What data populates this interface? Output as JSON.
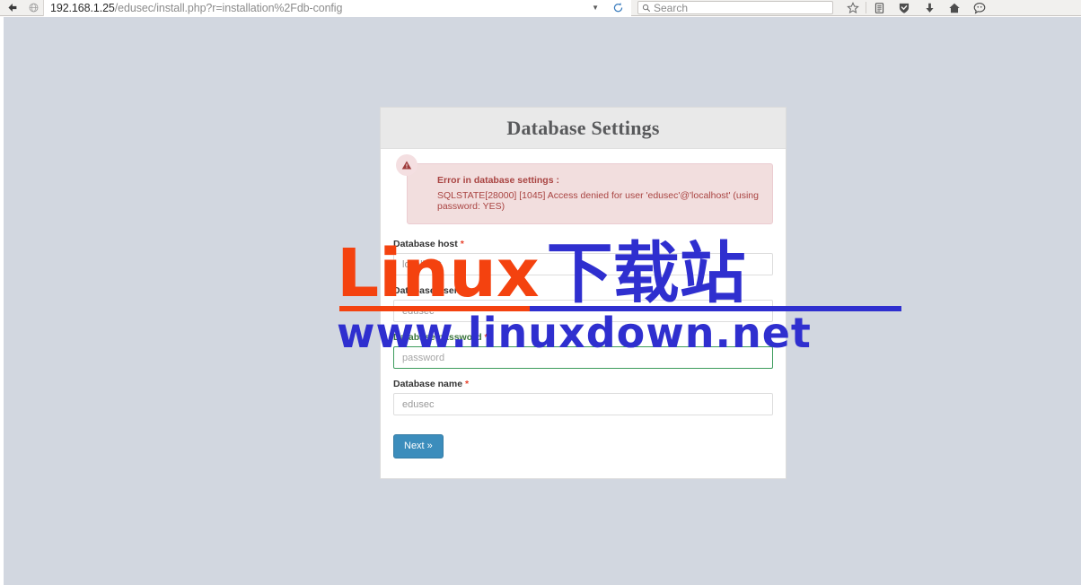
{
  "browser": {
    "back_icon": "back-arrow-icon",
    "site_icon": "globe-icon",
    "url_host": "192.168.1.25",
    "url_path": "/edusec/install.php?r=installation%2Fdb-config",
    "url_dropdown_icon": "chevron-down-icon",
    "reload_icon": "reload-icon",
    "search_placeholder": "Search",
    "search_icon": "search-icon",
    "toolbar_icons": [
      "star-icon",
      "reader-list-icon",
      "shield-icon",
      "download-icon",
      "home-icon",
      "account-icon"
    ]
  },
  "card": {
    "title": "Database Settings",
    "alert": {
      "icon": "warning-triangle-icon",
      "title": "Error in database settings :",
      "message": "SQLSTATE[28000] [1045] Access denied for user 'edusec'@'localhost' (using password: YES)"
    },
    "fields": [
      {
        "name": "database-host",
        "label": "Database host",
        "required": true,
        "value": "localhost",
        "placeholder": "localhost",
        "focused": false
      },
      {
        "name": "database-user",
        "label": "Database user",
        "required": true,
        "value": "edusec",
        "placeholder": "edusec",
        "focused": false
      },
      {
        "name": "database-password",
        "label": "Database password",
        "required": true,
        "value": "",
        "placeholder": "password",
        "focused": true
      },
      {
        "name": "database-name",
        "label": "Database name",
        "required": true,
        "value": "edusec",
        "placeholder": "edusec",
        "focused": false
      }
    ],
    "submit_label": "Next »"
  },
  "watermark": {
    "latin": "Linux",
    "cjk": "下载站",
    "url": "www.linuxdown.net",
    "color_red": "#f4420f",
    "color_blue": "#2f2fcf"
  },
  "colors": {
    "page_background": "#d2d7e0",
    "card_header": "#e9e9e9",
    "alert_background": "#f2dede",
    "alert_text": "#a94442",
    "button": "#3c8dbc",
    "focus_border": "#3c9c5c",
    "required_star": "#e8412a"
  }
}
